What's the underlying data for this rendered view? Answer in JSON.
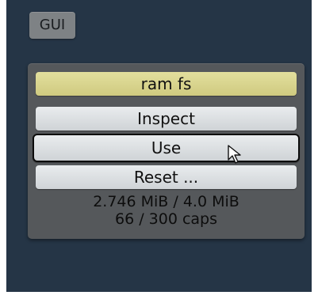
{
  "tab": {
    "label": "GUI"
  },
  "panel": {
    "title": "ram fs",
    "buttons": {
      "inspect": "Inspect",
      "use": "Use",
      "reset": "Reset ..."
    },
    "memory": "2.746 MiB / 4.0 MiB",
    "caps": "66 / 300 caps"
  },
  "icons": {
    "pointer": "mouse-pointer-icon"
  },
  "colors": {
    "background": "#253546",
    "panel": "#55585b",
    "title_bar": "#d9d58e",
    "button": "#dde0e3"
  }
}
